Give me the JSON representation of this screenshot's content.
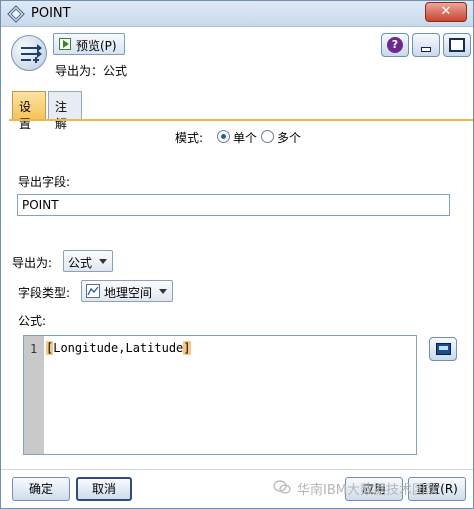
{
  "window": {
    "title": "POINT"
  },
  "toolbar": {
    "preview_label": "预览(P)",
    "export_summary": "导出为：公式"
  },
  "tabs": [
    {
      "label": "设置",
      "active": true
    },
    {
      "label": "注解",
      "active": false
    }
  ],
  "mode": {
    "label": "模式:",
    "options": [
      {
        "label": "单个",
        "selected": true
      },
      {
        "label": "多个",
        "selected": false
      }
    ]
  },
  "derive_field": {
    "label": "导出字段:",
    "value": "POINT"
  },
  "derive_as": {
    "label": "导出为:",
    "value": "公式"
  },
  "field_type": {
    "label": "字段类型:",
    "value": "地理空间"
  },
  "formula": {
    "label": "公式:",
    "line_number": "1",
    "open_bracket": "[",
    "code": "Longitude,Latitude",
    "close_bracket": "]"
  },
  "footer": {
    "ok_label": "确定",
    "cancel_label": "取消",
    "apply_label": "应用",
    "reset_label": "重置(R)",
    "watermark": "华南IBM大数据技术团队"
  },
  "colors": {
    "tab_active": "#f7c35a",
    "close_button": "#c9442f",
    "title_bar": "#c9d9ec"
  }
}
